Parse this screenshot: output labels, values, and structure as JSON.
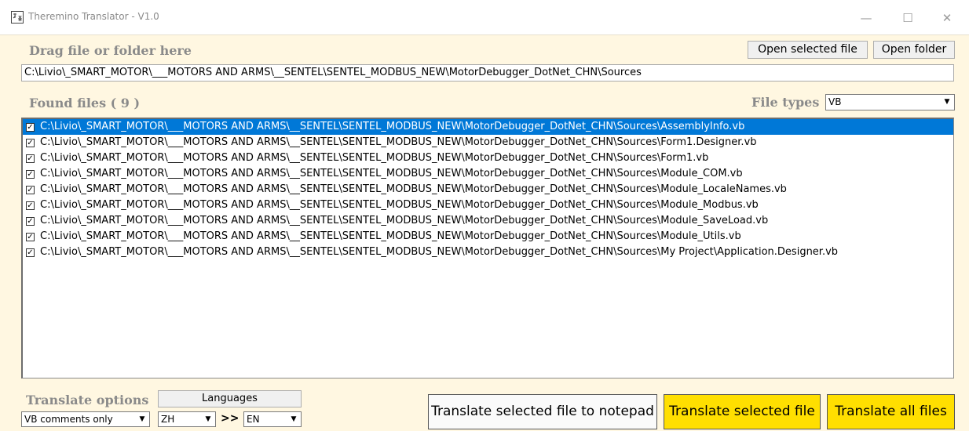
{
  "window": {
    "title": "Theremino Translator - V1.0",
    "minimize": "—",
    "maximize": "☐",
    "close": "✕"
  },
  "source": {
    "drag_label": "Drag file or folder here",
    "open_selected_label": "Open selected file",
    "open_folder_label": "Open folder",
    "path": "C:\\Livio\\_SMART_MOTOR\\___MOTORS AND ARMS\\__SENTEL\\SENTEL_MODBUS_NEW\\MotorDebugger_DotNet_CHN\\Sources"
  },
  "found": {
    "label": "Found files ( 9 )",
    "file_types_label": "File types",
    "file_type_value": "VB",
    "files": [
      {
        "path": "C:\\Livio\\_SMART_MOTOR\\___MOTORS AND ARMS\\__SENTEL\\SENTEL_MODBUS_NEW\\MotorDebugger_DotNet_CHN\\Sources\\AssemblyInfo.vb",
        "checked": true,
        "selected": true
      },
      {
        "path": "C:\\Livio\\_SMART_MOTOR\\___MOTORS AND ARMS\\__SENTEL\\SENTEL_MODBUS_NEW\\MotorDebugger_DotNet_CHN\\Sources\\Form1.Designer.vb",
        "checked": true,
        "selected": false
      },
      {
        "path": "C:\\Livio\\_SMART_MOTOR\\___MOTORS AND ARMS\\__SENTEL\\SENTEL_MODBUS_NEW\\MotorDebugger_DotNet_CHN\\Sources\\Form1.vb",
        "checked": true,
        "selected": false
      },
      {
        "path": "C:\\Livio\\_SMART_MOTOR\\___MOTORS AND ARMS\\__SENTEL\\SENTEL_MODBUS_NEW\\MotorDebugger_DotNet_CHN\\Sources\\Module_COM.vb",
        "checked": true,
        "selected": false
      },
      {
        "path": "C:\\Livio\\_SMART_MOTOR\\___MOTORS AND ARMS\\__SENTEL\\SENTEL_MODBUS_NEW\\MotorDebugger_DotNet_CHN\\Sources\\Module_LocaleNames.vb",
        "checked": true,
        "selected": false
      },
      {
        "path": "C:\\Livio\\_SMART_MOTOR\\___MOTORS AND ARMS\\__SENTEL\\SENTEL_MODBUS_NEW\\MotorDebugger_DotNet_CHN\\Sources\\Module_Modbus.vb",
        "checked": true,
        "selected": false
      },
      {
        "path": "C:\\Livio\\_SMART_MOTOR\\___MOTORS AND ARMS\\__SENTEL\\SENTEL_MODBUS_NEW\\MotorDebugger_DotNet_CHN\\Sources\\Module_SaveLoad.vb",
        "checked": true,
        "selected": false
      },
      {
        "path": "C:\\Livio\\_SMART_MOTOR\\___MOTORS AND ARMS\\__SENTEL\\SENTEL_MODBUS_NEW\\MotorDebugger_DotNet_CHN\\Sources\\Module_Utils.vb",
        "checked": true,
        "selected": false
      },
      {
        "path": "C:\\Livio\\_SMART_MOTOR\\___MOTORS AND ARMS\\__SENTEL\\SENTEL_MODBUS_NEW\\MotorDebugger_DotNet_CHN\\Sources\\My Project\\Application.Designer.vb",
        "checked": true,
        "selected": false
      }
    ]
  },
  "options": {
    "translate_options_label": "Translate options",
    "languages_label": "Languages",
    "mode_value": "VB comments only",
    "from_lang": "ZH",
    "arrow_text": ">>",
    "to_lang": "EN",
    "dropdown_glyph": "▼"
  },
  "actions": {
    "to_notepad_label": "Translate selected file to notepad",
    "translate_selected_label": "Translate selected file",
    "translate_all_label": "Translate all files"
  },
  "colors": {
    "background": "#fff7e1",
    "selection": "#0078d7",
    "yellow_button": "#ffdf00",
    "label_gray": "#8a8a8a"
  }
}
